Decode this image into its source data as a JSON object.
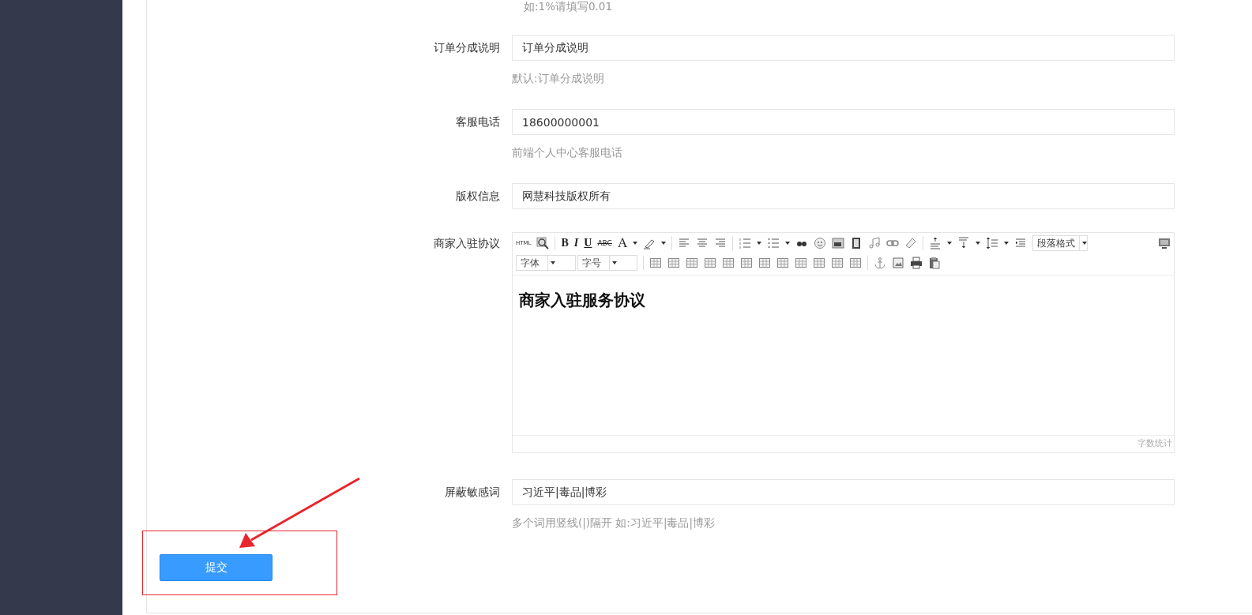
{
  "top_hint": "如:1%请填写0.01",
  "fields": [
    {
      "label": "订单分成说明",
      "value": "订单分成说明",
      "hint": "默认:订单分成说明"
    },
    {
      "label": "客服电话",
      "value": "18600000001",
      "hint": "前端个人中心客服电话"
    },
    {
      "label": "版权信息",
      "value": "网慧科技版权所有"
    }
  ],
  "editor": {
    "label": "商家入驻协议",
    "toolbar_texts": [
      "HTML",
      "B",
      "I",
      "U",
      "ABC",
      "A"
    ],
    "paragraph_select": "段落格式",
    "font_select": "字体",
    "size_select": "字号",
    "content": "商家入驻服务协议",
    "word_count": "字数统计"
  },
  "sensitive": {
    "label": "屏蔽敏感词",
    "value": "习近平|毒品|博彩",
    "hint": "多个词用竖线(|)隔开 如:习近平|毒品|博彩"
  },
  "submit": "提交"
}
